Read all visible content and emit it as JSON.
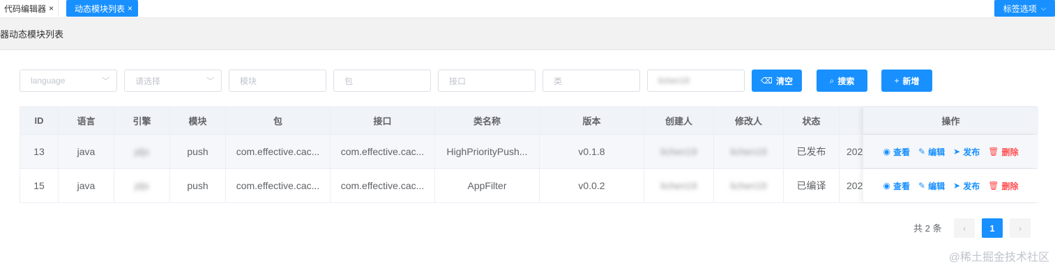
{
  "tabs": [
    {
      "label": "代码编辑器",
      "close": "×",
      "active": false
    },
    {
      "label": "动态模块列表",
      "close": "×",
      "active": true
    }
  ],
  "tab_options": {
    "label": "标签选项",
    "chevron": "⌵"
  },
  "breadcrumb": {
    "text": "器动态模块列表"
  },
  "filters": {
    "language_placeholder": "language",
    "select_placeholder": "请选择",
    "module_placeholder": "模块",
    "package_placeholder": "包",
    "interface_placeholder": "接口",
    "class_placeholder": "类",
    "creator_value": "lichen19"
  },
  "buttons": {
    "clear": {
      "icon": "⌫",
      "label": "清空"
    },
    "search": {
      "icon": "⌕",
      "label": "搜索"
    },
    "add": {
      "icon": "+",
      "label": "新增"
    }
  },
  "table": {
    "headers": [
      "ID",
      "语言",
      "引擎",
      "模块",
      "包",
      "接口",
      "类名称",
      "版本",
      "创建人",
      "修改人",
      "状态",
      "",
      "操作"
    ],
    "rows": [
      {
        "id": "13",
        "lang": "java",
        "engine": "jdjs",
        "module": "push",
        "pkg": "com.effective.cac...",
        "iface": "com.effective.cac...",
        "cls": "HighPriorityPush...",
        "ver": "v0.1.8",
        "creator": "lichen19",
        "modifier": "lichen19",
        "status": "已发布",
        "time": "202"
      },
      {
        "id": "15",
        "lang": "java",
        "engine": "jdjs",
        "module": "push",
        "pkg": "com.effective.cac...",
        "iface": "com.effective.cac...",
        "cls": "AppFilter",
        "ver": "v0.0.2",
        "creator": "lichen19",
        "modifier": "lichen19",
        "status": "已编译",
        "time": "202"
      }
    ],
    "actions": {
      "view": "查看",
      "edit": "编辑",
      "publish": "发布",
      "delete": "删除"
    }
  },
  "pagination": {
    "total": "共 2 条",
    "prev": "‹",
    "current": "1",
    "next": "›"
  },
  "watermark": "@稀土掘金技术社区",
  "colors": {
    "primary": "#1890ff",
    "danger": "#ff4d4f"
  }
}
